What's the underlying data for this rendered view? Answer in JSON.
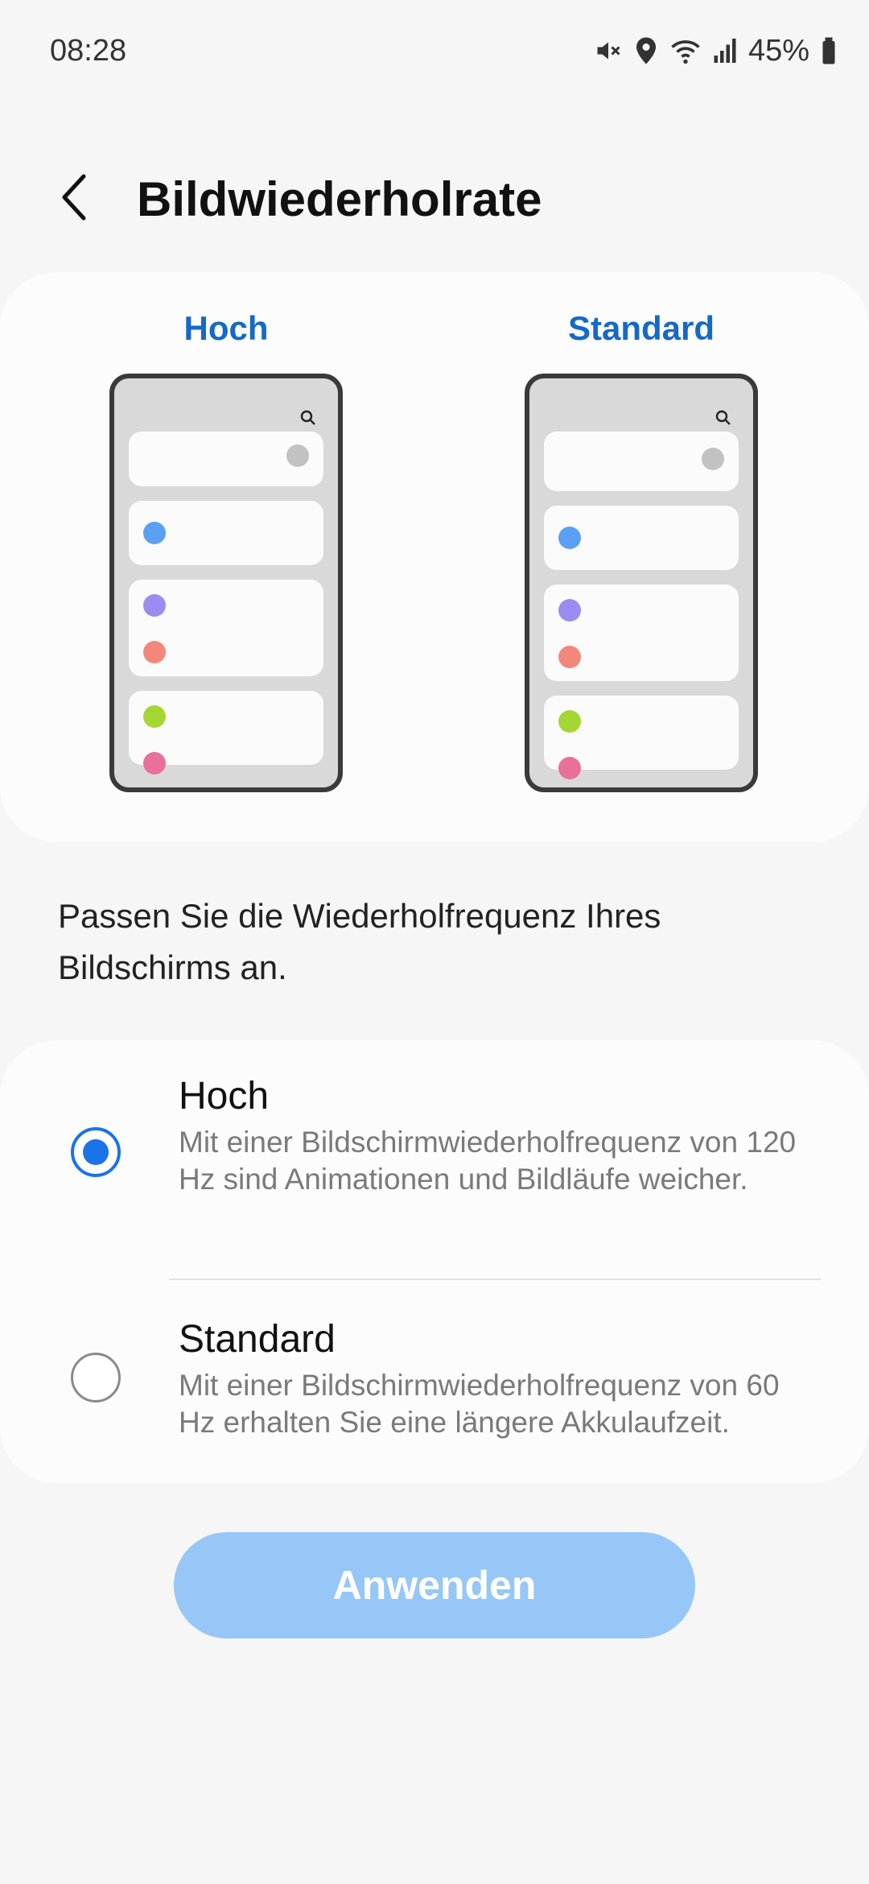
{
  "status_bar": {
    "time": "08:28",
    "battery_percent": "45%",
    "icons": [
      "mute-icon",
      "location-icon",
      "wifi-icon",
      "signal-icon",
      "battery-icon"
    ]
  },
  "header": {
    "title": "Bildwiederholrate",
    "back_icon": "back-arrow-icon"
  },
  "preview": {
    "left_label": "Hoch",
    "right_label": "Standard",
    "dot_colors": [
      "#c2c2c2",
      "#5aa1f5",
      "#9b8cf2",
      "#f2887a",
      "#a5d634",
      "#e8709a"
    ]
  },
  "description": "Passen Sie die Wiederholfrequenz Ihres Bildschirms an.",
  "options": [
    {
      "title": "Hoch",
      "description": "Mit einer Bildschirmwiederholfrequenz von 120 Hz sind Animationen und Bildläufe weicher.",
      "selected": true
    },
    {
      "title": "Standard",
      "description": "Mit einer Bildschirmwiederholfrequenz von 60 Hz erhalten Sie eine längere Akkulaufzeit.",
      "selected": false
    }
  ],
  "apply_button": {
    "label": "Anwenden",
    "enabled": false
  },
  "colors": {
    "accent": "#1a73e8",
    "preview_label": "#1569c7",
    "button_disabled": "#96c7f7",
    "background": "#f6f6f6"
  }
}
